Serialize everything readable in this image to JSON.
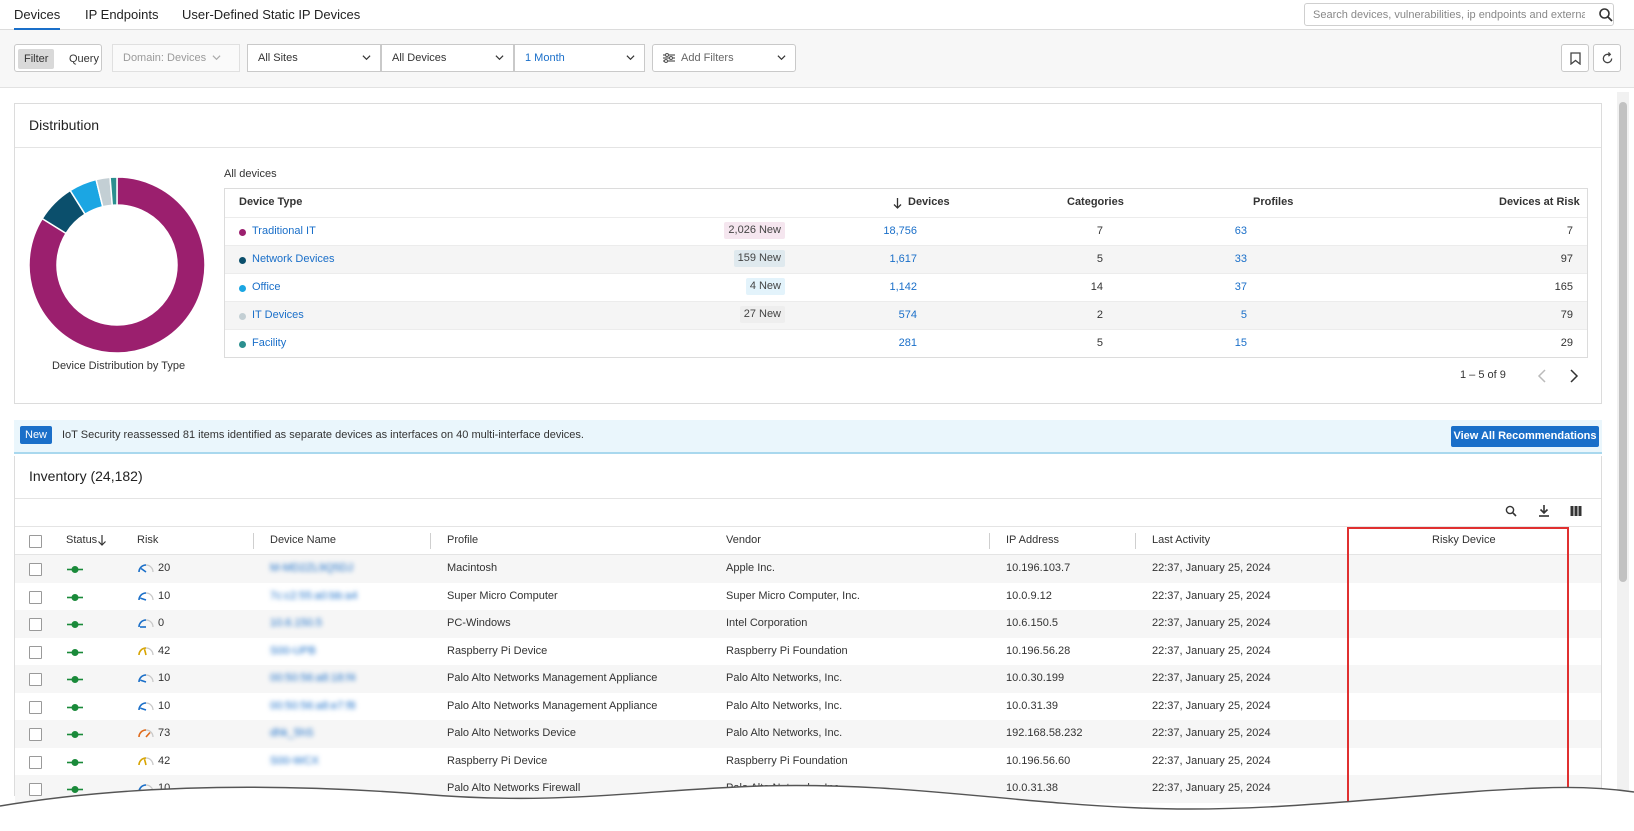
{
  "tabs": [
    {
      "label": "Devices",
      "active": true
    },
    {
      "label": "IP Endpoints",
      "active": false
    },
    {
      "label": "User-Defined Static IP Devices",
      "active": false
    }
  ],
  "search": {
    "placeholder": "Search devices, vulnerabilities, ip endpoints and external des..."
  },
  "filterbar": {
    "mode": {
      "filter": "Filter",
      "query": "Query"
    },
    "domain": "Domain: Devices",
    "sites": "All Sites",
    "devices": "All Devices",
    "period": "1 Month",
    "add_filters": "Add Filters"
  },
  "distribution": {
    "title": "Distribution",
    "chart_caption": "Device Distribution by Type",
    "table_caption": "All devices",
    "headers": {
      "type": "Device Type",
      "devices": "Devices",
      "categories": "Categories",
      "profiles": "Profiles",
      "risk": "Devices at Risk"
    },
    "rows": [
      {
        "type": "Traditional IT",
        "badge": "2,026 New",
        "devices": "18,756",
        "categories": "7",
        "profiles": "63",
        "risk": "7",
        "color": "#9b1f6e",
        "badge_bg": "#f5e6ef"
      },
      {
        "type": "Network Devices",
        "badge": "159 New",
        "devices": "1,617",
        "categories": "5",
        "profiles": "33",
        "risk": "97",
        "color": "#0b4f6c",
        "badge_bg": "#dfe9ee"
      },
      {
        "type": "Office",
        "badge": "4 New",
        "devices": "1,142",
        "categories": "14",
        "profiles": "37",
        "risk": "165",
        "color": "#1ba6e3",
        "badge_bg": "#e3f3fb"
      },
      {
        "type": "IT Devices",
        "badge": "27 New",
        "devices": "574",
        "categories": "2",
        "profiles": "5",
        "risk": "79",
        "color": "#c3cfd4",
        "badge_bg": "#eeeeee"
      },
      {
        "type": "Facility",
        "badge": "",
        "devices": "281",
        "categories": "5",
        "profiles": "15",
        "risk": "29",
        "color": "#2b8f8f",
        "badge_bg": "#ffffff"
      }
    ],
    "pagination": "1 – 5 of 9"
  },
  "banner": {
    "tag": "New",
    "text": "IoT Security reassessed 81 items identified as separate devices as interfaces on 40 multi-interface devices.",
    "button": "View All Recommendations"
  },
  "inventory": {
    "title": "Inventory (24,182)",
    "headers": {
      "status": "Status",
      "risk": "Risk",
      "name": "Device Name",
      "profile": "Profile",
      "vendor": "Vendor",
      "ip": "IP Address",
      "activity": "Last Activity",
      "risky": "Risky Device"
    },
    "rows": [
      {
        "risk": "20",
        "risk_color": "#1a6fc9",
        "name": "M-MD2ZL9Q5DJ",
        "profile": "Macintosh",
        "vendor": "Apple Inc.",
        "ip": "10.196.103.7",
        "activity": "22:37, January 25, 2024"
      },
      {
        "risk": "10",
        "risk_color": "#1a6fc9",
        "name": "7c:c2:55:a0:bb:a4",
        "profile": "Super Micro Computer",
        "vendor": "Super Micro Computer, Inc.",
        "ip": "10.0.9.12",
        "activity": "22:37, January 25, 2024"
      },
      {
        "risk": "0",
        "risk_color": "#1a6fc9",
        "name": "10.6.150.5",
        "profile": "PC-Windows",
        "vendor": "Intel Corporation",
        "ip": "10.6.150.5",
        "activity": "22:37, January 25, 2024"
      },
      {
        "risk": "42",
        "risk_color": "#d8a400",
        "name": "S00-UPB",
        "profile": "Raspberry Pi Device",
        "vendor": "Raspberry Pi Foundation",
        "ip": "10.196.56.28",
        "activity": "22:37, January 25, 2024"
      },
      {
        "risk": "10",
        "risk_color": "#1a6fc9",
        "name": "00:50:56:a8:18:f4",
        "profile": "Palo Alto Networks Management Appliance",
        "vendor": "Palo Alto Networks, Inc.",
        "ip": "10.0.30.199",
        "activity": "22:37, January 25, 2024"
      },
      {
        "risk": "10",
        "risk_color": "#1a6fc9",
        "name": "00:50:56:a8:e7:f8",
        "profile": "Palo Alto Networks Management Appliance",
        "vendor": "Palo Alto Networks, Inc.",
        "ip": "10.0.31.39",
        "activity": "22:37, January 25, 2024"
      },
      {
        "risk": "73",
        "risk_color": "#e06a1a",
        "name": "dhk_5hS",
        "profile": "Palo Alto Networks Device",
        "vendor": "Palo Alto Networks, Inc.",
        "ip": "192.168.58.232",
        "activity": "22:37, January 25, 2024"
      },
      {
        "risk": "42",
        "risk_color": "#d8a400",
        "name": "S00-WCX",
        "profile": "Raspberry Pi Device",
        "vendor": "Raspberry Pi Foundation",
        "ip": "10.196.56.60",
        "activity": "22:37, January 25, 2024"
      },
      {
        "risk": "10",
        "risk_color": "#1a6fc9",
        "name": "",
        "profile": "Palo Alto Networks Firewall",
        "vendor": "Palo Alto Networks, Inc.",
        "ip": "10.0.31.38",
        "activity": "22:37, January 25, 2024"
      }
    ]
  },
  "colors": {
    "accent": "#1a6fc9",
    "highlight": "#e03030",
    "status_green": "#1a8a3a"
  }
}
